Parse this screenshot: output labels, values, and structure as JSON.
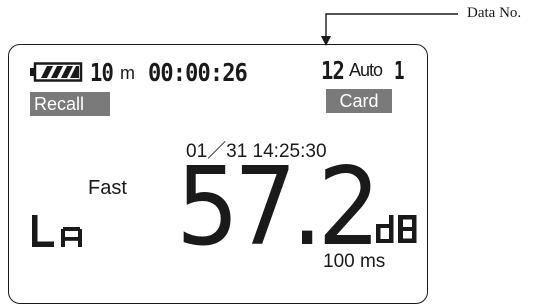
{
  "callout": {
    "label": "Data No."
  },
  "display": {
    "battery_icon": "battery-full-icon",
    "interval": {
      "value": "10",
      "unit": "m"
    },
    "elapsed_time": "00:00:26",
    "data_number": "12",
    "mode": {
      "label": "Auto",
      "value": "1"
    },
    "recall_label": "Recall",
    "card_label": "Card",
    "datetime": "01／31 14:25:30",
    "time_weighting": "Fast",
    "level_symbol": "LA",
    "level": {
      "value": "57.2",
      "unit": "dB"
    },
    "measure_period": "100 ms"
  }
}
